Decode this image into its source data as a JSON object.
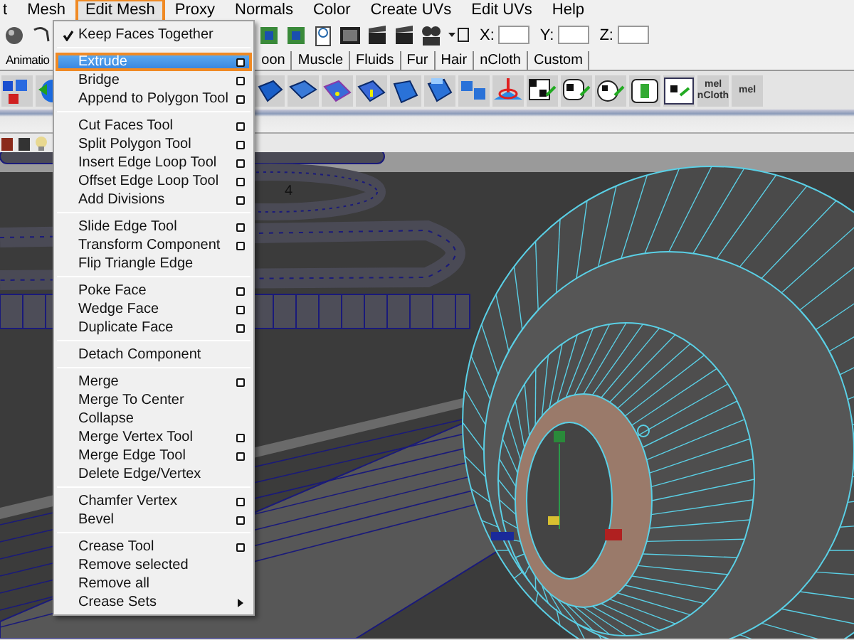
{
  "menubar": [
    {
      "label": "t",
      "selected": false
    },
    {
      "label": "Mesh",
      "selected": false
    },
    {
      "label": "Edit Mesh",
      "selected": true
    },
    {
      "label": "Proxy",
      "selected": false
    },
    {
      "label": "Normals",
      "selected": false
    },
    {
      "label": "Color",
      "selected": false
    },
    {
      "label": "Create UVs",
      "selected": false
    },
    {
      "label": "Edit UVs",
      "selected": false
    },
    {
      "label": "Help",
      "selected": false
    }
  ],
  "toolbar": {
    "coordinate_fields": [
      {
        "label": "X:"
      },
      {
        "label": "Y:"
      },
      {
        "label": "Z:"
      }
    ]
  },
  "shelf_tabs": [
    {
      "label": "Animatio"
    },
    {
      "label": "oon"
    },
    {
      "label": "Muscle"
    },
    {
      "label": "Fluids"
    },
    {
      "label": "Fur"
    },
    {
      "label": "Hair"
    },
    {
      "label": "nCloth"
    },
    {
      "label": "Custom"
    }
  ],
  "shelf_buttons": [
    {
      "label": "mel",
      "caption": "nCloth"
    },
    {
      "label": "mel"
    }
  ],
  "viewport": {
    "label": "4"
  },
  "menu": {
    "sections": [
      [
        {
          "label": "Keep Faces Together",
          "kind": "check",
          "checked": true,
          "option_box": false,
          "selected": false
        }
      ],
      [
        {
          "label": "Extrude",
          "kind": "command",
          "option_box": true,
          "selected": true
        },
        {
          "label": "Bridge",
          "kind": "command",
          "option_box": true,
          "selected": false
        },
        {
          "label": "Append to Polygon Tool",
          "kind": "command",
          "option_box": true,
          "selected": false
        }
      ],
      [
        {
          "label": "Cut Faces Tool",
          "kind": "command",
          "option_box": true,
          "selected": false
        },
        {
          "label": "Split Polygon Tool",
          "kind": "command",
          "option_box": true,
          "selected": false
        },
        {
          "label": "Insert Edge Loop Tool",
          "kind": "command",
          "option_box": true,
          "selected": false
        },
        {
          "label": "Offset Edge Loop Tool",
          "kind": "command",
          "option_box": true,
          "selected": false
        },
        {
          "label": "Add Divisions",
          "kind": "command",
          "option_box": true,
          "selected": false
        }
      ],
      [
        {
          "label": "Slide Edge Tool",
          "kind": "command",
          "option_box": true,
          "selected": false
        },
        {
          "label": "Transform Component",
          "kind": "command",
          "option_box": true,
          "selected": false
        },
        {
          "label": "Flip Triangle Edge",
          "kind": "command",
          "option_box": false,
          "selected": false
        }
      ],
      [
        {
          "label": "Poke Face",
          "kind": "command",
          "option_box": true,
          "selected": false
        },
        {
          "label": "Wedge Face",
          "kind": "command",
          "option_box": true,
          "selected": false
        },
        {
          "label": "Duplicate Face",
          "kind": "command",
          "option_box": true,
          "selected": false
        }
      ],
      [
        {
          "label": "Detach Component",
          "kind": "command",
          "option_box": false,
          "selected": false
        }
      ],
      [
        {
          "label": "Merge",
          "kind": "command",
          "option_box": true,
          "selected": false
        },
        {
          "label": "Merge To Center",
          "kind": "command",
          "option_box": false,
          "selected": false
        },
        {
          "label": "Collapse",
          "kind": "command",
          "option_box": false,
          "selected": false
        },
        {
          "label": "Merge Vertex Tool",
          "kind": "command",
          "option_box": true,
          "selected": false
        },
        {
          "label": "Merge Edge Tool",
          "kind": "command",
          "option_box": true,
          "selected": false
        },
        {
          "label": "Delete Edge/Vertex",
          "kind": "command",
          "option_box": false,
          "selected": false
        }
      ],
      [
        {
          "label": "Chamfer Vertex",
          "kind": "command",
          "option_box": true,
          "selected": false
        },
        {
          "label": "Bevel",
          "kind": "command",
          "option_box": true,
          "selected": false
        }
      ],
      [
        {
          "label": "Crease Tool",
          "kind": "command",
          "option_box": true,
          "selected": false
        },
        {
          "label": "Remove selected",
          "kind": "command",
          "option_box": false,
          "selected": false
        },
        {
          "label": "Remove all",
          "kind": "command",
          "option_box": false,
          "selected": false
        },
        {
          "label": "Crease Sets",
          "kind": "submenu",
          "option_box": false,
          "selected": false
        }
      ]
    ]
  }
}
